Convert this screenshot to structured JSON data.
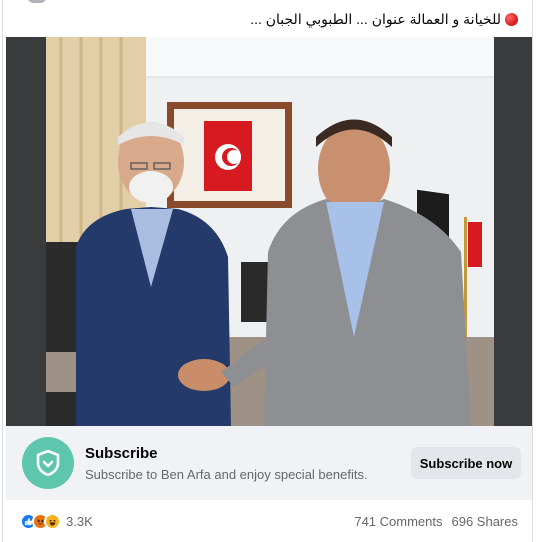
{
  "post": {
    "text": "للخيانة و العمالة عنوان ... الطبوبي الجبان ...",
    "red_circle_icon": "red-circle-emoji"
  },
  "photo": {
    "flag_colors": {
      "red": "#d71920",
      "white": "#ffffff"
    }
  },
  "subscribe": {
    "icon": "shield-badge-icon",
    "icon_color": "#5ec6ad",
    "title": "Subscribe",
    "description": "Subscribe to Ben Arfa and enjoy special benefits.",
    "button_label": "Subscribe now"
  },
  "engagement": {
    "reaction_icons": [
      "like-icon",
      "angry-icon",
      "haha-icon"
    ],
    "reaction_count": "3.3K",
    "comments": "741 Comments",
    "shares": "696 Shares"
  }
}
